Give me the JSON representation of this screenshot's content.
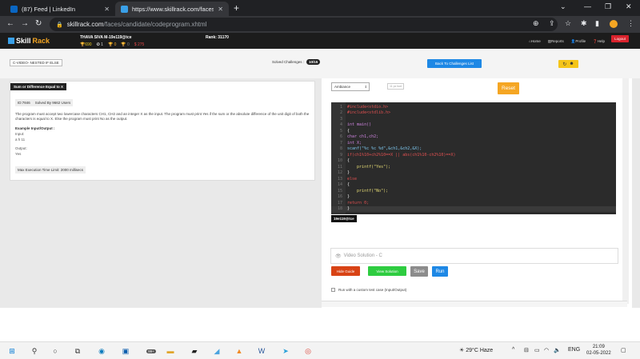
{
  "browser": {
    "tabs": [
      {
        "title": "(87) Feed | LinkedIn",
        "favicon_color": "#0a66c2",
        "active": false
      },
      {
        "title": "https://www.skillrack.com/faces/ca",
        "favicon_color": "#3aa0e8",
        "active": true
      }
    ],
    "url_host": "skillrack.com",
    "url_path": "/faces/candidate/codeprogram.xhtml"
  },
  "site": {
    "logo_skill": "Skill",
    "logo_rack": "Rack",
    "user_name": "THAVA SIVA M-19e119@tce",
    "stats": {
      "points": "690",
      "gold": "1",
      "silver": "0",
      "bronze": "0",
      "other": "275"
    },
    "rank": "Rank: 31170",
    "nav": {
      "home": "Home",
      "reports": "Reports",
      "profile": "Profile",
      "help": "Help"
    },
    "logout": "Logout"
  },
  "subbar": {
    "crumb": "C-VIDEO- NESTED IF ELSE",
    "solved_label": "Solved Challenges :",
    "solved_value": "10/15",
    "back_button": "Back To Challenges List"
  },
  "problem": {
    "title": "Sum or Difference Equal to X",
    "id": "ID:7846",
    "solved_by": "Solved By 9662 Users",
    "description": "The program must accept two lowercase characters CH1, CH2 and an integer X as the input. The program must print Yes if the sum or the absolute difference of the unit digit of both the characters is equal to X. Else the program must print No as the output.",
    "example_label": "Example Input/Output :",
    "input_label": "Input:",
    "input_value": "a h 11",
    "output_label": "Output:",
    "output_value": "Yes",
    "time_limit": "Max Execution Time Limit: 2000 millisecs"
  },
  "editor": {
    "theme": "Ambiance",
    "font_size": "11 px font",
    "reset": "Reset",
    "lines": [
      {
        "n": "1",
        "text": "#include<stdio.h>",
        "cls": "kw-inc"
      },
      {
        "n": "2",
        "text": "#include<stdlib.h>",
        "cls": "kw-inc"
      },
      {
        "n": "3",
        "text": "",
        "cls": "plain"
      },
      {
        "n": "4",
        "text": "int main()",
        "cls": "kw"
      },
      {
        "n": "5",
        "text": "{",
        "cls": "plain"
      },
      {
        "n": "6",
        "text": "char ch1,ch2;",
        "cls": "kw"
      },
      {
        "n": "7",
        "text": "int X;",
        "cls": "kw"
      },
      {
        "n": "8",
        "text": "scanf(\"%c %c %d\",&ch1,&ch2,&X);",
        "cls": "fn"
      },
      {
        "n": "9",
        "text": "if(ch1%10+ch2%10==X || abs(ch1%10-ch2%10)==X)",
        "cls": "kwr"
      },
      {
        "n": "10",
        "text": "{",
        "cls": "plain"
      },
      {
        "n": "11",
        "text": "    printf(\"Yes\");",
        "cls": "str"
      },
      {
        "n": "12",
        "text": "}",
        "cls": "plain"
      },
      {
        "n": "13",
        "text": "else",
        "cls": "kwr"
      },
      {
        "n": "14",
        "text": "{",
        "cls": "plain"
      },
      {
        "n": "15",
        "text": "    printf(\"No\");",
        "cls": "str"
      },
      {
        "n": "16",
        "text": "}",
        "cls": "plain"
      },
      {
        "n": "17",
        "text": "return 0;",
        "cls": "kwr"
      },
      {
        "n": "18",
        "text": "}",
        "cls": "plain"
      }
    ],
    "tooltip": "19e119@tce"
  },
  "video": {
    "label": "Video Solution - C"
  },
  "buttons": {
    "hide_guide": "Hide Guide",
    "view_solution": "View Solution",
    "save": "Save",
    "run": "Run"
  },
  "custom_test": "Run with a custom test case (Input/Output)",
  "taskbar": {
    "weather": "29°C  Haze",
    "lang": "ENG",
    "time": "21:09",
    "date": "02-05-2022",
    "badge": "99+"
  },
  "colors": {
    "accent_blue": "#1e88e5",
    "reset_orange": "#f5a623",
    "hide_guide": "#d84315",
    "view_solution": "#2ecc40",
    "save": "#8c8c8c",
    "run": "#1e88e5"
  }
}
